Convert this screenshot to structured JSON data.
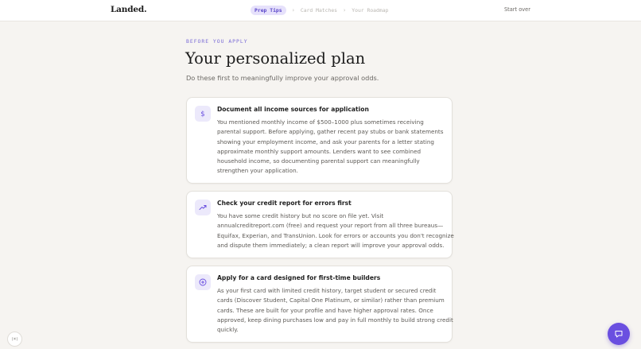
{
  "header": {
    "logo": "Landed.",
    "steps": [
      {
        "label": "Prep Tips",
        "active": true
      },
      {
        "label": "Card Matches",
        "active": false
      },
      {
        "label": "Your Roadmap",
        "active": false
      }
    ],
    "start_over": "Start over"
  },
  "main": {
    "eyebrow": "BEFORE YOU APPLY",
    "title": "Your personalized plan",
    "subtitle": "Do these first to meaningfully improve your approval odds.",
    "tips": [
      {
        "icon": "dollar-icon",
        "title": "Document all income sources for application",
        "lines": [
          "You mentioned monthly income of $500–1000 plus sometimes receiving",
          "parental support. Before applying, gather recent pay stubs or bank statements",
          "showing your employment income, and ask your parents for a letter stating",
          "approximate monthly support amounts. Lenders want to see combined",
          "household income, so documenting parental support can meaningfully",
          "strengthen your application."
        ]
      },
      {
        "icon": "trending-up-icon",
        "title": "Check your credit report for errors first",
        "lines": [
          "You have some credit history but no score on file yet. Visit",
          "annualcreditreport.com (free) and request your report from all three bureaus—",
          "Equifax, Experian, and TransUnion. Look for errors or accounts you don't recognize",
          "and dispute them immediately; a clean report will improve your approval odds."
        ]
      },
      {
        "icon": "plus-circle-icon",
        "title": "Apply for a card designed for first-time builders",
        "lines": [
          "As your first card with limited credit history, target student or secured credit",
          "cards (Discover Student, Capital One Platinum, or similar) rather than premium",
          "cards. These are built for your profile and have higher approval rates. Once",
          "approved, keep dining purchases low and pay in full monthly to build strong credit",
          "quickly."
        ]
      }
    ]
  },
  "widgets": {
    "small_button": "(⌘)"
  },
  "colors": {
    "accent": "#6a4fe0",
    "accent_soft": "#ece9fb",
    "background": "#f6f4f1"
  }
}
